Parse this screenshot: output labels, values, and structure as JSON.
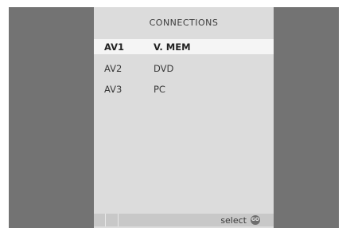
{
  "menu": {
    "title": "CONNECTIONS",
    "rows": [
      {
        "key": "AV1",
        "value": "V. MEM",
        "selected": true
      },
      {
        "key": "AV2",
        "value": "DVD",
        "selected": false
      },
      {
        "key": "AV3",
        "value": "PC",
        "selected": false
      }
    ]
  },
  "footer": {
    "label": "select",
    "button_icon_text": "GO"
  },
  "colors": {
    "backdrop": "#737373",
    "panel": "#dcdcdc",
    "highlight": "#f5f5f5",
    "text": "#3a3a3a"
  }
}
